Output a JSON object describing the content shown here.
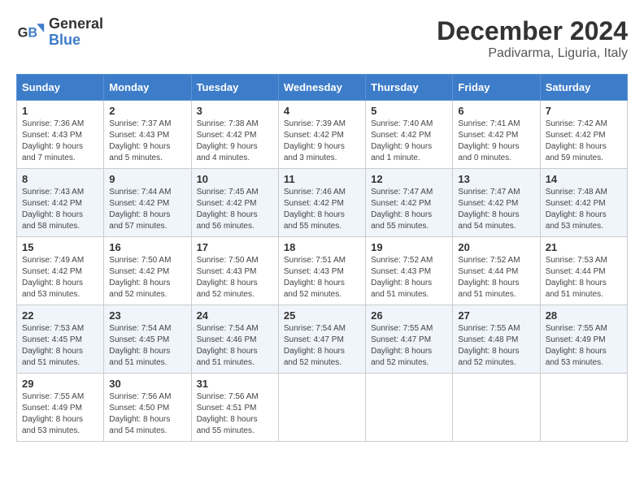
{
  "header": {
    "logo_line1": "General",
    "logo_line2": "Blue",
    "month": "December 2024",
    "location": "Padivarma, Liguria, Italy"
  },
  "days_of_week": [
    "Sunday",
    "Monday",
    "Tuesday",
    "Wednesday",
    "Thursday",
    "Friday",
    "Saturday"
  ],
  "weeks": [
    [
      {
        "day": 1,
        "info": "Sunrise: 7:36 AM\nSunset: 4:43 PM\nDaylight: 9 hours\nand 7 minutes."
      },
      {
        "day": 2,
        "info": "Sunrise: 7:37 AM\nSunset: 4:43 PM\nDaylight: 9 hours\nand 5 minutes."
      },
      {
        "day": 3,
        "info": "Sunrise: 7:38 AM\nSunset: 4:42 PM\nDaylight: 9 hours\nand 4 minutes."
      },
      {
        "day": 4,
        "info": "Sunrise: 7:39 AM\nSunset: 4:42 PM\nDaylight: 9 hours\nand 3 minutes."
      },
      {
        "day": 5,
        "info": "Sunrise: 7:40 AM\nSunset: 4:42 PM\nDaylight: 9 hours\nand 1 minute."
      },
      {
        "day": 6,
        "info": "Sunrise: 7:41 AM\nSunset: 4:42 PM\nDaylight: 9 hours\nand 0 minutes."
      },
      {
        "day": 7,
        "info": "Sunrise: 7:42 AM\nSunset: 4:42 PM\nDaylight: 8 hours\nand 59 minutes."
      }
    ],
    [
      {
        "day": 8,
        "info": "Sunrise: 7:43 AM\nSunset: 4:42 PM\nDaylight: 8 hours\nand 58 minutes."
      },
      {
        "day": 9,
        "info": "Sunrise: 7:44 AM\nSunset: 4:42 PM\nDaylight: 8 hours\nand 57 minutes."
      },
      {
        "day": 10,
        "info": "Sunrise: 7:45 AM\nSunset: 4:42 PM\nDaylight: 8 hours\nand 56 minutes."
      },
      {
        "day": 11,
        "info": "Sunrise: 7:46 AM\nSunset: 4:42 PM\nDaylight: 8 hours\nand 55 minutes."
      },
      {
        "day": 12,
        "info": "Sunrise: 7:47 AM\nSunset: 4:42 PM\nDaylight: 8 hours\nand 55 minutes."
      },
      {
        "day": 13,
        "info": "Sunrise: 7:47 AM\nSunset: 4:42 PM\nDaylight: 8 hours\nand 54 minutes."
      },
      {
        "day": 14,
        "info": "Sunrise: 7:48 AM\nSunset: 4:42 PM\nDaylight: 8 hours\nand 53 minutes."
      }
    ],
    [
      {
        "day": 15,
        "info": "Sunrise: 7:49 AM\nSunset: 4:42 PM\nDaylight: 8 hours\nand 53 minutes."
      },
      {
        "day": 16,
        "info": "Sunrise: 7:50 AM\nSunset: 4:42 PM\nDaylight: 8 hours\nand 52 minutes."
      },
      {
        "day": 17,
        "info": "Sunrise: 7:50 AM\nSunset: 4:43 PM\nDaylight: 8 hours\nand 52 minutes."
      },
      {
        "day": 18,
        "info": "Sunrise: 7:51 AM\nSunset: 4:43 PM\nDaylight: 8 hours\nand 52 minutes."
      },
      {
        "day": 19,
        "info": "Sunrise: 7:52 AM\nSunset: 4:43 PM\nDaylight: 8 hours\nand 51 minutes."
      },
      {
        "day": 20,
        "info": "Sunrise: 7:52 AM\nSunset: 4:44 PM\nDaylight: 8 hours\nand 51 minutes."
      },
      {
        "day": 21,
        "info": "Sunrise: 7:53 AM\nSunset: 4:44 PM\nDaylight: 8 hours\nand 51 minutes."
      }
    ],
    [
      {
        "day": 22,
        "info": "Sunrise: 7:53 AM\nSunset: 4:45 PM\nDaylight: 8 hours\nand 51 minutes."
      },
      {
        "day": 23,
        "info": "Sunrise: 7:54 AM\nSunset: 4:45 PM\nDaylight: 8 hours\nand 51 minutes."
      },
      {
        "day": 24,
        "info": "Sunrise: 7:54 AM\nSunset: 4:46 PM\nDaylight: 8 hours\nand 51 minutes."
      },
      {
        "day": 25,
        "info": "Sunrise: 7:54 AM\nSunset: 4:47 PM\nDaylight: 8 hours\nand 52 minutes."
      },
      {
        "day": 26,
        "info": "Sunrise: 7:55 AM\nSunset: 4:47 PM\nDaylight: 8 hours\nand 52 minutes."
      },
      {
        "day": 27,
        "info": "Sunrise: 7:55 AM\nSunset: 4:48 PM\nDaylight: 8 hours\nand 52 minutes."
      },
      {
        "day": 28,
        "info": "Sunrise: 7:55 AM\nSunset: 4:49 PM\nDaylight: 8 hours\nand 53 minutes."
      }
    ],
    [
      {
        "day": 29,
        "info": "Sunrise: 7:55 AM\nSunset: 4:49 PM\nDaylight: 8 hours\nand 53 minutes."
      },
      {
        "day": 30,
        "info": "Sunrise: 7:56 AM\nSunset: 4:50 PM\nDaylight: 8 hours\nand 54 minutes."
      },
      {
        "day": 31,
        "info": "Sunrise: 7:56 AM\nSunset: 4:51 PM\nDaylight: 8 hours\nand 55 minutes."
      },
      null,
      null,
      null,
      null
    ]
  ]
}
